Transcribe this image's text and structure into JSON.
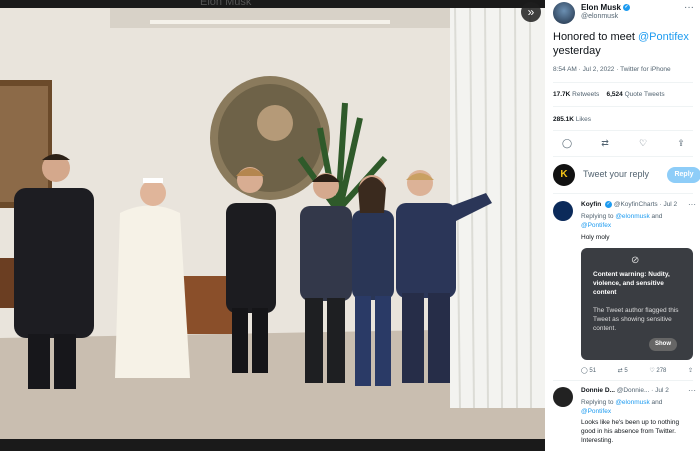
{
  "photo": {
    "top_label": "Elon Musk",
    "expand_icon": "double-chevron-right-icon"
  },
  "tweet": {
    "author_name": "Elon Musk",
    "author_handle": "@elonmusk",
    "text_prefix": "Honored to meet ",
    "mention": "@Pontifex",
    "text_suffix": "yesterday",
    "meta": "8:54 AM · Jul 2, 2022 · Twitter for iPhone",
    "retweets_count": "17.7K",
    "retweets_label": "Retweets",
    "quotes_count": "6,524",
    "quotes_label": "Quote Tweets",
    "likes_count": "285.1K",
    "likes_label": "Likes"
  },
  "reply_composer": {
    "placeholder": "Tweet your reply",
    "button": "Reply"
  },
  "replies": [
    {
      "name": "Koyfin",
      "handle_date": "@KoyfinCharts · Jul 2",
      "replying_prefix": "Replying to ",
      "replying_to_1": "@elonmusk",
      "replying_and": " and",
      "replying_to_2": "@Pontifex",
      "text": "Holy moly",
      "warning_title": "Content warning: Nudity, violence, and sensitive content",
      "warning_body": "The Tweet author flagged this Tweet as showing sensitive content.",
      "warning_button": "Show",
      "reply_count": "51",
      "retweet_count": "5",
      "like_count": "278"
    },
    {
      "name": "Donnie D...",
      "handle_date": "@Donnie... · Jul 2",
      "replying_prefix": "Replying to ",
      "replying_to_1": "@elonmusk",
      "replying_and": " and",
      "replying_to_2": "@Pontifex",
      "text": "Looks like he's been up to nothing good in his absence from Twitter. Interesting."
    }
  ]
}
